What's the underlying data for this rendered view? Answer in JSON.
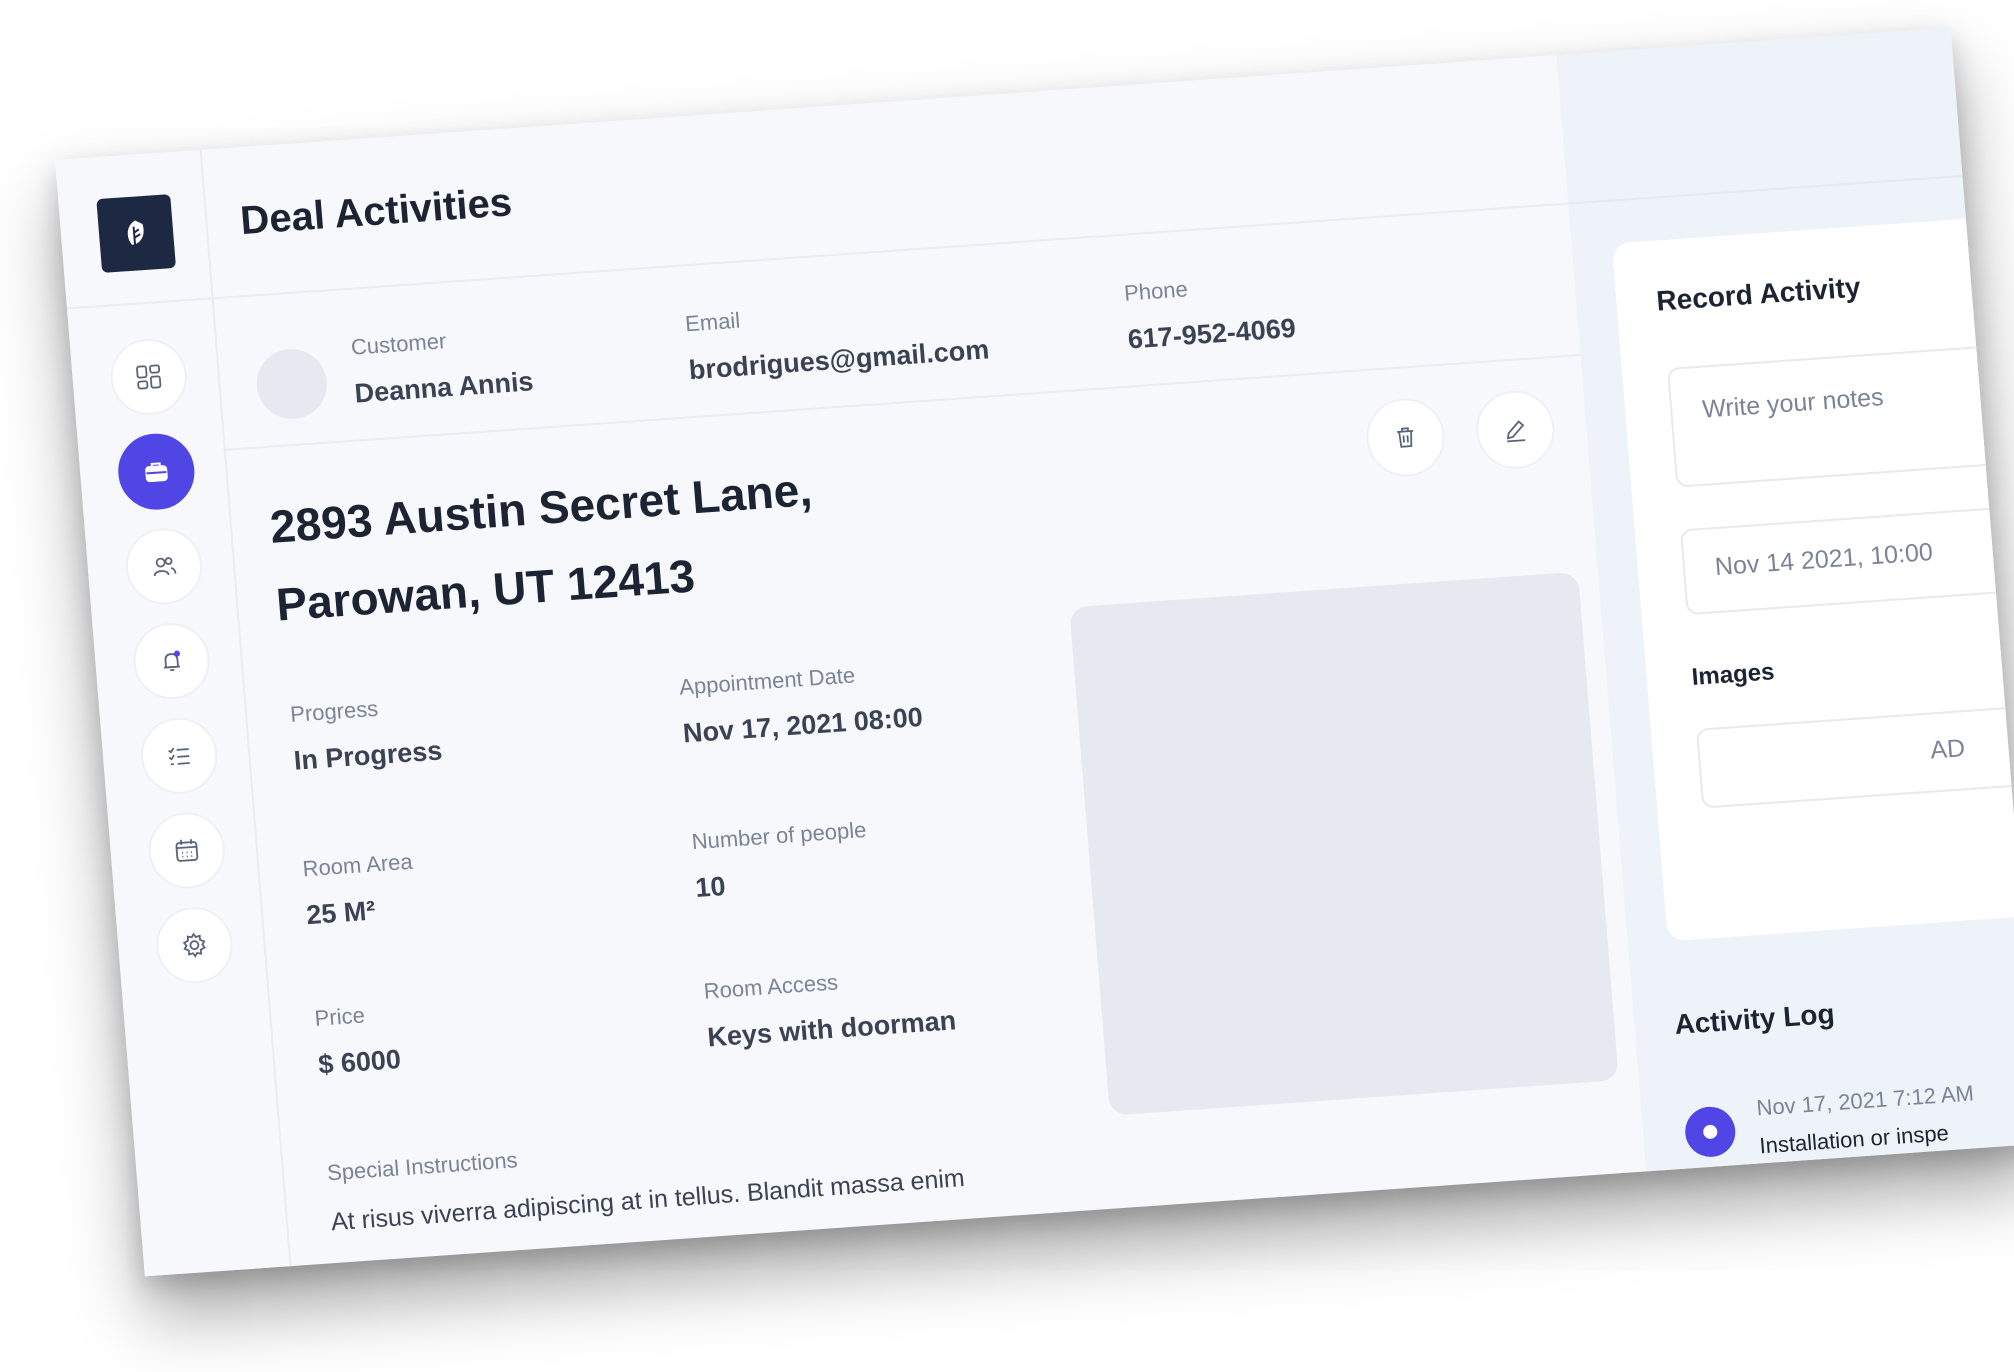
{
  "header": {
    "title": "Deal Activities"
  },
  "sidebar": {
    "items": [
      {
        "icon": "dashboard-icon",
        "active": false
      },
      {
        "icon": "briefcase-icon",
        "active": true
      },
      {
        "icon": "users-icon",
        "active": false
      },
      {
        "icon": "bell-icon",
        "active": false
      },
      {
        "icon": "checklist-icon",
        "active": false
      },
      {
        "icon": "calendar-icon",
        "active": false
      },
      {
        "icon": "gear-icon",
        "active": false
      }
    ]
  },
  "customer": {
    "customer_label": "Customer",
    "customer_name": "Deanna Annis",
    "email_label": "Email",
    "email": "brodrigues@gmail.com",
    "phone_label": "Phone",
    "phone": "617-952-4069"
  },
  "deal": {
    "address_line1": "2893 Austin Secret Lane,",
    "address_line2": "Parowan, UT 12413",
    "progress_label": "Progress",
    "progress": "In Progress",
    "appointment_label": "Appointment Date",
    "appointment": "Nov 17, 2021 08:00",
    "room_area_label": "Room Area",
    "room_area": "25 M²",
    "people_label": "Number of people",
    "people": "10",
    "price_label": "Price",
    "price": "$ 6000",
    "access_label": "Room Access",
    "access": "Keys with doorman",
    "instructions_label": "Special Instructions",
    "instructions": "At risus viverra adipiscing at in tellus. Blandit massa enim"
  },
  "record_activity": {
    "title": "Record Activity",
    "notes_placeholder": "Write your notes",
    "date_value": "Nov 14 2021, 10:00",
    "images_label": "Images",
    "add_label": "AD"
  },
  "activity_log": {
    "title": "Activity Log",
    "entries": [
      {
        "time": "Nov 17, 2021 7:12 AM",
        "text": "Installation or inspe"
      }
    ]
  },
  "colors": {
    "accent": "#4f46e5",
    "logo_bg": "#1d2942",
    "background": "#f6f8fc"
  }
}
